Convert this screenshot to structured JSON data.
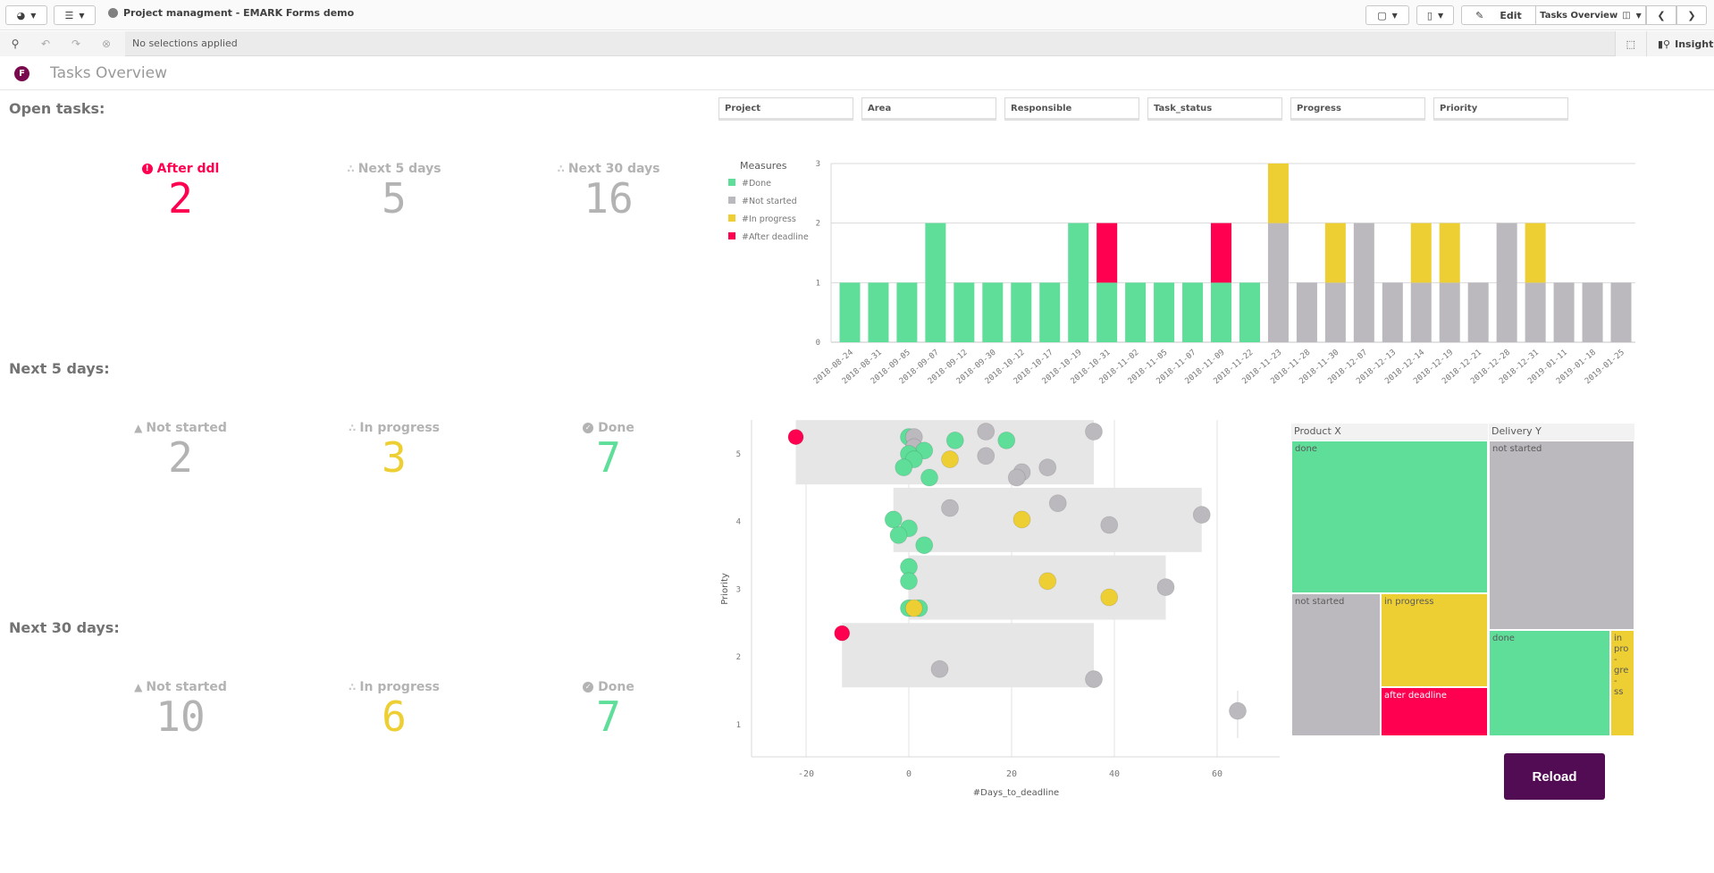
{
  "toolbar": {
    "app_title": "Project managment - EMARK Forms demo",
    "edit_label": "Edit",
    "sheet_selector": "Tasks Overview",
    "selections_text": "No selections applied",
    "insights_label": "Insights"
  },
  "sheet": {
    "logo_letter": "F",
    "title": "Tasks Overview"
  },
  "sections": {
    "open": "Open tasks:",
    "next5": "Next 5 days:",
    "next30": "Next 30 days:"
  },
  "kpis": {
    "open": [
      {
        "label": "After ddl",
        "value": "2",
        "icon": "exclamation-circle-icon",
        "color": "#ff0050",
        "label_color": "#ff0050"
      },
      {
        "label": "Next 5 days",
        "value": "5",
        "icon": "spinner-icon",
        "color": "#b3b3b3",
        "label_color": "#b3b3b3"
      },
      {
        "label": "Next 30 days",
        "value": "16",
        "icon": "spinner-icon",
        "color": "#b3b3b3",
        "label_color": "#b3b3b3"
      }
    ],
    "next5": [
      {
        "label": "Not started",
        "value": "2",
        "icon": "warning-icon",
        "color": "#b3b3b3"
      },
      {
        "label": "In progress",
        "value": "3",
        "icon": "spinner-icon",
        "color": "#edcf34"
      },
      {
        "label": "Done",
        "value": "7",
        "icon": "check-circle-icon",
        "color": "#5ede99"
      }
    ],
    "next30": [
      {
        "label": "Not started",
        "value": "10",
        "icon": "warning-icon",
        "color": "#b3b3b3"
      },
      {
        "label": "In progress",
        "value": "6",
        "icon": "spinner-icon",
        "color": "#edcf34"
      },
      {
        "label": "Done",
        "value": "7",
        "icon": "check-circle-icon",
        "color": "#5ede99"
      }
    ]
  },
  "filters": [
    "Project",
    "Area",
    "Responsible",
    "Task_status",
    "Progress",
    "Priority"
  ],
  "colors": {
    "done": "#5ede99",
    "not_started": "#bbb9bd",
    "in_progress": "#edcf34",
    "after_deadline": "#ff0050",
    "brand": "#520c54"
  },
  "reload_label": "Reload",
  "chart_data": [
    {
      "type": "bar",
      "stacked": true,
      "legend_title": "Measures",
      "legend_position": "left",
      "ylim": [
        0,
        3
      ],
      "yticks": [
        "0",
        "1",
        "2",
        "3"
      ],
      "categories": [
        "2018-08-24",
        "2018-08-31",
        "2018-09-05",
        "2018-09-07",
        "2018-09-12",
        "2018-09-30",
        "2018-10-12",
        "2018-10-17",
        "2018-10-19",
        "2018-10-31",
        "2018-11-02",
        "2018-11-05",
        "2018-11-07",
        "2018-11-09",
        "2018-11-22",
        "2018-11-23",
        "2018-11-28",
        "2018-11-30",
        "2018-12-07",
        "2018-12-13",
        "2018-12-14",
        "2018-12-19",
        "2018-12-21",
        "2018-12-28",
        "2018-12-31",
        "2019-01-11",
        "2019-01-18",
        "2019-01-25"
      ],
      "series": [
        {
          "name": "#Done",
          "key": "done",
          "values": [
            1,
            1,
            1,
            2,
            1,
            1,
            1,
            1,
            2,
            1,
            1,
            1,
            1,
            1,
            1,
            0,
            0,
            0,
            0,
            0,
            0,
            0,
            0,
            0,
            0,
            0,
            0,
            0
          ]
        },
        {
          "name": "#Not started",
          "key": "not_started",
          "values": [
            0,
            0,
            0,
            0,
            0,
            0,
            0,
            0,
            0,
            0,
            0,
            0,
            0,
            0,
            0,
            2,
            1,
            1,
            2,
            1,
            1,
            1,
            1,
            2,
            1,
            1,
            1,
            1
          ]
        },
        {
          "name": "#In progress",
          "key": "in_progress",
          "values": [
            0,
            0,
            0,
            0,
            0,
            0,
            0,
            0,
            0,
            0,
            0,
            0,
            0,
            0,
            0,
            1,
            0,
            1,
            0,
            0,
            1,
            1,
            0,
            0,
            1,
            0,
            0,
            0
          ]
        },
        {
          "name": "#After deadline",
          "key": "after_deadline",
          "values": [
            0,
            0,
            0,
            0,
            0,
            0,
            0,
            0,
            0,
            1,
            0,
            0,
            0,
            1,
            0,
            0,
            0,
            0,
            0,
            0,
            0,
            0,
            0,
            0,
            0,
            0,
            0,
            0
          ]
        }
      ]
    },
    {
      "type": "scatter",
      "xlabel": "#Days_to_deadline",
      "ylabel": "Priority",
      "xlim": [
        -32,
        72
      ],
      "ylim": [
        0.8,
        5.4
      ],
      "xticks": [
        -20,
        0,
        20,
        40,
        60
      ],
      "yticks": [
        1,
        2,
        3,
        4,
        5
      ],
      "bands": [
        {
          "priority": 5,
          "x_min": -22,
          "x_max": 36
        },
        {
          "priority": 4,
          "x_min": -3,
          "x_max": 57
        },
        {
          "priority": 3,
          "x_min": 0,
          "x_max": 50
        },
        {
          "priority": 2,
          "x_min": -13,
          "x_max": 36
        },
        {
          "priority": 1,
          "x_min": 64,
          "x_max": 64
        }
      ],
      "points": [
        {
          "x": -22,
          "y": 5.25,
          "status": "after_deadline"
        },
        {
          "x": 0,
          "y": 5.25,
          "status": "done"
        },
        {
          "x": 1,
          "y": 5.25,
          "status": "not_started"
        },
        {
          "x": 1,
          "y": 5.1,
          "status": "not_started"
        },
        {
          "x": 3,
          "y": 5.05,
          "status": "done"
        },
        {
          "x": 0,
          "y": 5.0,
          "status": "done"
        },
        {
          "x": 1,
          "y": 4.92,
          "status": "done"
        },
        {
          "x": -1,
          "y": 4.8,
          "status": "done"
        },
        {
          "x": 4,
          "y": 4.65,
          "status": "done"
        },
        {
          "x": 8,
          "y": 4.92,
          "status": "in_progress"
        },
        {
          "x": 9,
          "y": 5.2,
          "status": "done"
        },
        {
          "x": 15,
          "y": 5.33,
          "status": "not_started"
        },
        {
          "x": 15,
          "y": 4.97,
          "status": "not_started"
        },
        {
          "x": 19,
          "y": 5.2,
          "status": "done"
        },
        {
          "x": 22,
          "y": 4.73,
          "status": "not_started"
        },
        {
          "x": 21,
          "y": 4.65,
          "status": "not_started"
        },
        {
          "x": 27,
          "y": 4.8,
          "status": "not_started"
        },
        {
          "x": 36,
          "y": 5.33,
          "status": "not_started"
        },
        {
          "x": -3,
          "y": 4.03,
          "status": "done"
        },
        {
          "x": 0,
          "y": 3.9,
          "status": "done"
        },
        {
          "x": -2,
          "y": 3.8,
          "status": "done"
        },
        {
          "x": 3,
          "y": 3.65,
          "status": "done"
        },
        {
          "x": 8,
          "y": 4.2,
          "status": "not_started"
        },
        {
          "x": 22,
          "y": 4.03,
          "status": "in_progress"
        },
        {
          "x": 29,
          "y": 4.27,
          "status": "not_started"
        },
        {
          "x": 39,
          "y": 3.95,
          "status": "not_started"
        },
        {
          "x": 57,
          "y": 4.1,
          "status": "not_started"
        },
        {
          "x": 0,
          "y": 3.33,
          "status": "done"
        },
        {
          "x": 0,
          "y": 3.12,
          "status": "done"
        },
        {
          "x": 0,
          "y": 2.72,
          "status": "done"
        },
        {
          "x": 2,
          "y": 2.72,
          "status": "done"
        },
        {
          "x": 1,
          "y": 2.72,
          "status": "in_progress"
        },
        {
          "x": 27,
          "y": 3.12,
          "status": "in_progress"
        },
        {
          "x": 39,
          "y": 2.88,
          "status": "in_progress"
        },
        {
          "x": 50,
          "y": 3.03,
          "status": "not_started"
        },
        {
          "x": -13,
          "y": 2.35,
          "status": "after_deadline"
        },
        {
          "x": 6,
          "y": 1.82,
          "status": "not_started"
        },
        {
          "x": 36,
          "y": 1.67,
          "status": "not_started"
        },
        {
          "x": 64,
          "y": 1.2,
          "status": "not_started"
        }
      ]
    },
    {
      "type": "treemap",
      "groups": [
        {
          "name": "Product X",
          "cells": [
            {
              "label": "done",
              "status": "done"
            },
            {
              "label": "not started",
              "status": "not_started"
            },
            {
              "label": "in progress",
              "status": "in_progress"
            },
            {
              "label": "after deadline",
              "status": "after_deadline"
            }
          ]
        },
        {
          "name": "Delivery Y",
          "cells": [
            {
              "label": "not started",
              "status": "not_started"
            },
            {
              "label": "done",
              "status": "done"
            },
            {
              "label": "in pro-gre-ss",
              "status": "in_progress"
            }
          ]
        }
      ]
    }
  ]
}
